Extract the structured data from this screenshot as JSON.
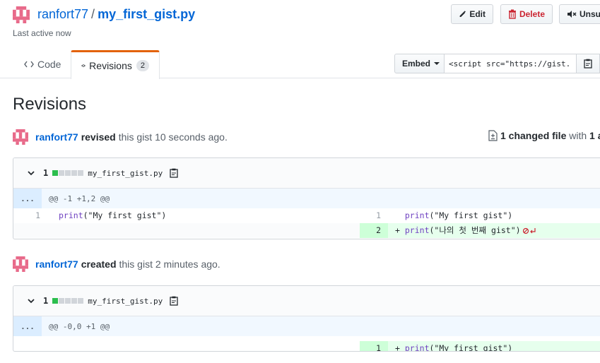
{
  "header": {
    "owner": "ranfort77",
    "separator": "/",
    "gist_name": "my_first_gist.py",
    "last_active": "Last active now",
    "edit_label": "Edit",
    "delete_label": "Delete",
    "unsubscribe_label": "Unsu"
  },
  "tabs": [
    {
      "label": "Code",
      "icon": "code-icon"
    },
    {
      "label": "Revisions",
      "icon": "git-commit-icon",
      "count": "2"
    }
  ],
  "embed": {
    "label": "Embed",
    "value": "<script src=\"https://gist."
  },
  "page_title": "Revisions",
  "revisions": [
    {
      "user": "ranfort77",
      "action": "revised",
      "text": "this gist 10 seconds ago.",
      "changed": "1 changed file",
      "changed_rest": " with ",
      "changed_tail": "1 a",
      "file": {
        "count": "1",
        "name": "my_first_gist.py",
        "hunk": "@@ -1 +1,2 @@",
        "lines": [
          {
            "left_num": "1",
            "left_fn": "print",
            "left_str": "(\"My first gist\")",
            "right_num": "1",
            "right_prefix": " ",
            "right_fn": "print",
            "right_str": "(\"My first gist\")"
          },
          {
            "right_num": "2",
            "right_prefix": "+",
            "right_fn": "print",
            "right_str": "(\"나의 첫 번째 gist\")"
          }
        ]
      }
    },
    {
      "user": "ranfort77",
      "action": "created",
      "text": "this gist 2 minutes ago.",
      "file": {
        "count": "1",
        "name": "my_first_gist.py",
        "hunk": "@@ -0,0 +1 @@",
        "lines": [
          {
            "right_num": "1",
            "right_prefix": "+",
            "right_fn": "print",
            "right_str": "(\"My first gist\")"
          }
        ]
      }
    }
  ],
  "expander": "...",
  "colors": {
    "link": "#0366d6",
    "danger": "#cb2431",
    "tab_accent": "#e36209",
    "addition": "#e6ffed"
  }
}
